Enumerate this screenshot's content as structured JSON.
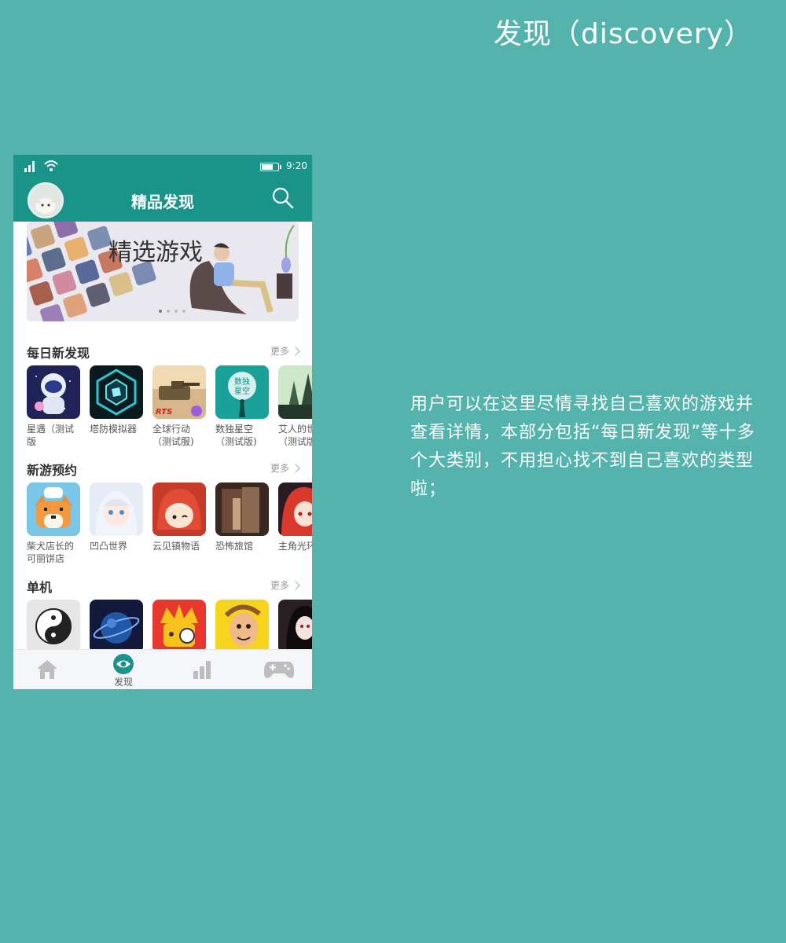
{
  "page": {
    "title": "发现（discovery）",
    "description": "用户可以在这里尽情寻找自己喜欢的游戏并查看详情，本部分包括“每日新发现”等十多个大类别，不用担心找不到自己喜欢的类型啦；"
  },
  "status_bar": {
    "time": "9:20",
    "battery_level": 0.7
  },
  "app_bar": {
    "title": "精品发现"
  },
  "banner": {
    "text": "精选游戏"
  },
  "sections": [
    {
      "title": "每日新发现",
      "more": "更多",
      "games": [
        {
          "name": "星遇（测试版",
          "icon": "astronaut-icon"
        },
        {
          "name": "塔防模拟器",
          "icon": "hex-tower-icon"
        },
        {
          "name": "全球行动（测试服)",
          "icon": "tank-rts-icon",
          "badge": "RTS"
        },
        {
          "name": "数独星空（测试版)",
          "icon": "sudoku-star-icon",
          "badge": "数独星空"
        },
        {
          "name": "艾人的世（测试版",
          "icon": "forest-icon"
        }
      ]
    },
    {
      "title": "新游预约",
      "more": "更多",
      "games": [
        {
          "name": "柴犬店长的可丽饼店",
          "icon": "shiba-chef-icon"
        },
        {
          "name": "凹凸世界",
          "icon": "anime-girl-icon"
        },
        {
          "name": "云见镇物语",
          "icon": "red-hood-icon"
        },
        {
          "name": "恐怖旅馆",
          "icon": "haunted-door-icon"
        },
        {
          "name": "主角光环",
          "icon": "red-hair-girl-icon"
        }
      ]
    },
    {
      "title": "单机",
      "more": "更多",
      "games": [
        {
          "name": "",
          "icon": "yin-yang-icon"
        },
        {
          "name": "",
          "icon": "blue-planet-icon"
        },
        {
          "name": "",
          "icon": "crown-detective-icon"
        },
        {
          "name": "",
          "icon": "cartoon-face-icon"
        },
        {
          "name": "",
          "icon": "dark-portrait-icon"
        }
      ]
    }
  ],
  "tab_bar": {
    "tabs": [
      {
        "label": "",
        "icon": "home-icon"
      },
      {
        "label": "发现",
        "icon": "eye-icon",
        "active": true
      },
      {
        "label": "",
        "icon": "bar-chart-icon"
      },
      {
        "label": "",
        "icon": "gamepad-icon"
      }
    ]
  },
  "colors": {
    "background": "#54b3ad",
    "primary": "#1a9488",
    "tab_inactive": "#bdbdbd"
  }
}
